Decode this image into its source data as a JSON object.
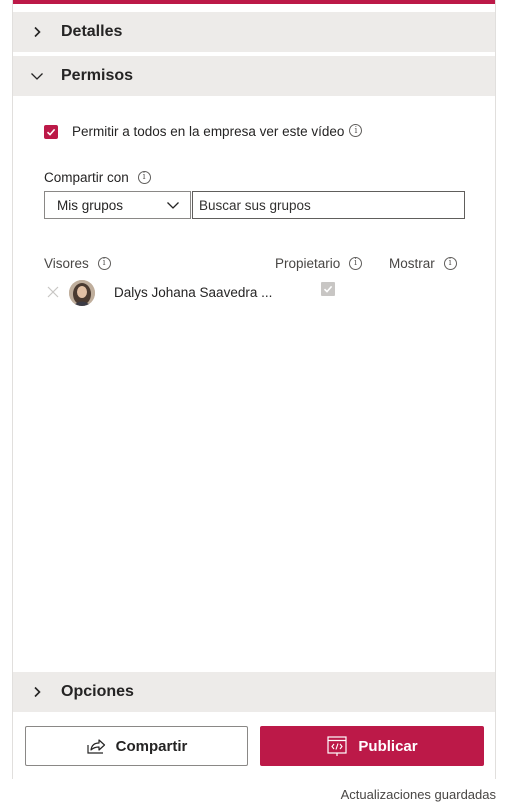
{
  "sections": {
    "details": {
      "title": "Detalles",
      "expanded": false
    },
    "permissions": {
      "title": "Permisos",
      "expanded": true
    },
    "options": {
      "title": "Opciones",
      "expanded": false
    }
  },
  "permissions": {
    "allow_company_label": "Permitir a todos en la empresa ver este vídeo",
    "allow_company_checked": true,
    "share_with_label": "Compartir con",
    "share_scope_selected": "Mis grupos",
    "search_placeholder": "Buscar sus grupos",
    "columns": {
      "viewers": "Visores",
      "owner": "Propietario",
      "show": "Mostrar"
    },
    "viewers": [
      {
        "name": "Dalys Johana Saavedra ...",
        "owner": true,
        "owner_disabled": true
      }
    ]
  },
  "actions": {
    "share_label": "Compartir",
    "publish_label": "Publicar"
  },
  "status": "Actualizaciones guardadas",
  "colors": {
    "accent": "#bc1948",
    "section_bg": "#edebe9"
  }
}
